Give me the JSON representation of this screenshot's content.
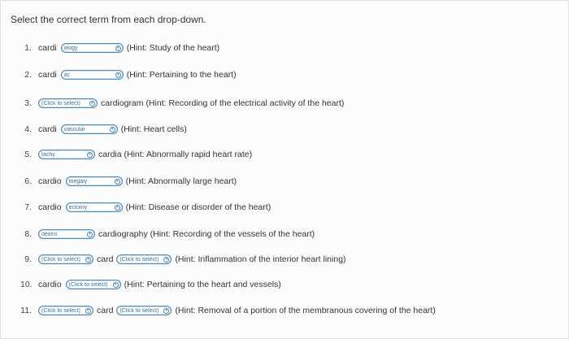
{
  "instruction": "Select the correct term from each drop-down.",
  "items": [
    {
      "num": "1.",
      "pre": "cardi",
      "s1": "ology",
      "post": "(Hint: Study of the heart)"
    },
    {
      "num": "2.",
      "pre": "cardi",
      "s1": "ac",
      "post": "(Hint: Pertaining to the heart)"
    },
    {
      "num": "3.",
      "s1": "(Click to select)",
      "post": "cardiogram (Hint: Recording of the electrical activity of the heart)"
    },
    {
      "num": "4.",
      "pre": "cardi",
      "s1": "vascular",
      "post": "(Hint: Heart cells)"
    },
    {
      "num": "5.",
      "s1": "tachy",
      "post": "cardia (Hint: Abnormally rapid heart rate)"
    },
    {
      "num": "6.",
      "pre": "cardio",
      "s1": "megaly",
      "post": "(Hint: Abnormally large heart)"
    },
    {
      "num": "7.",
      "pre": "cardio",
      "s1": "ectomy",
      "post": "(Hint: Disease or disorder of the heart)"
    },
    {
      "num": "8.",
      "s1": "dextro",
      "post": "cardiography (Hint: Recording of the vessels of the heart)"
    },
    {
      "num": "9.",
      "s1": "(Click to select)",
      "mid": "card",
      "s2": "(Click to select)",
      "post": "(Hint: Inflammation of the interior heart lining)"
    },
    {
      "num": "10.",
      "pre": "cardio",
      "s1": "(Click to select)",
      "post": "(Hint: Pertaining to the heart and vessels)"
    },
    {
      "num": "11.",
      "s1": "(Click to select)",
      "mid": "card",
      "s2": "(Click to select)",
      "post": "(Hint: Removal of a portion of the membranous covering of the heart)"
    }
  ],
  "icons": {
    "dropdown": "chevron-down-icon"
  },
  "colors": {
    "accent": "#4a88bd",
    "text": "#333333"
  }
}
